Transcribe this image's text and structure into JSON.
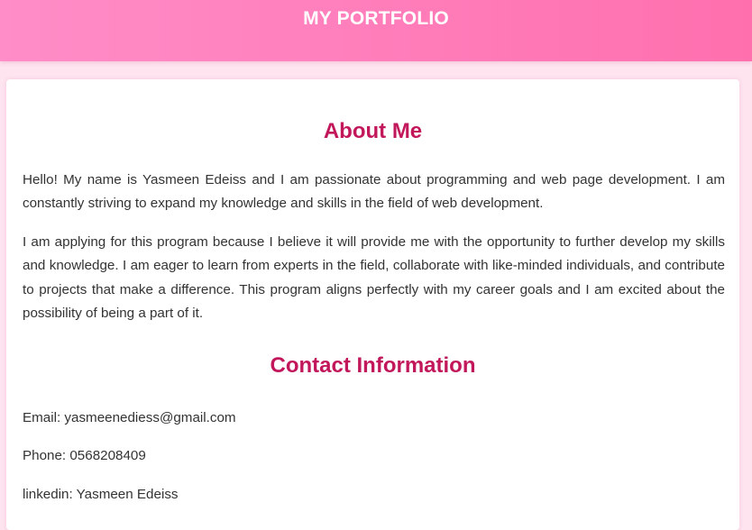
{
  "header": {
    "title": "MY PORTFOLIO"
  },
  "about": {
    "heading": "About Me",
    "paragraphs": [
      "Hello! My name is Yasmeen Edeiss and I am passionate about programming and web page development. I am constantly striving to expand my knowledge and skills in the field of web development.",
      "I am applying for this program because I believe it will provide me with the opportunity to further develop my skills and knowledge. I am eager to learn from experts in the field, collaborate with like-minded individuals, and contribute to projects that make a difference. This program aligns perfectly with my career goals and I am excited about the possibility of being a part of it."
    ]
  },
  "contact": {
    "heading": "Contact Information",
    "email": "Email: yasmeenediess@gmail.com",
    "phone": "Phone: 0568208409",
    "linkedin": "linkedin: Yasmeen Edeiss"
  },
  "colors": {
    "header_gradient_start": "#ff8dc7",
    "header_gradient_end": "#ff6fae",
    "heading": "#c2185b",
    "page_background": "#fde4ef",
    "text": "#333333"
  }
}
